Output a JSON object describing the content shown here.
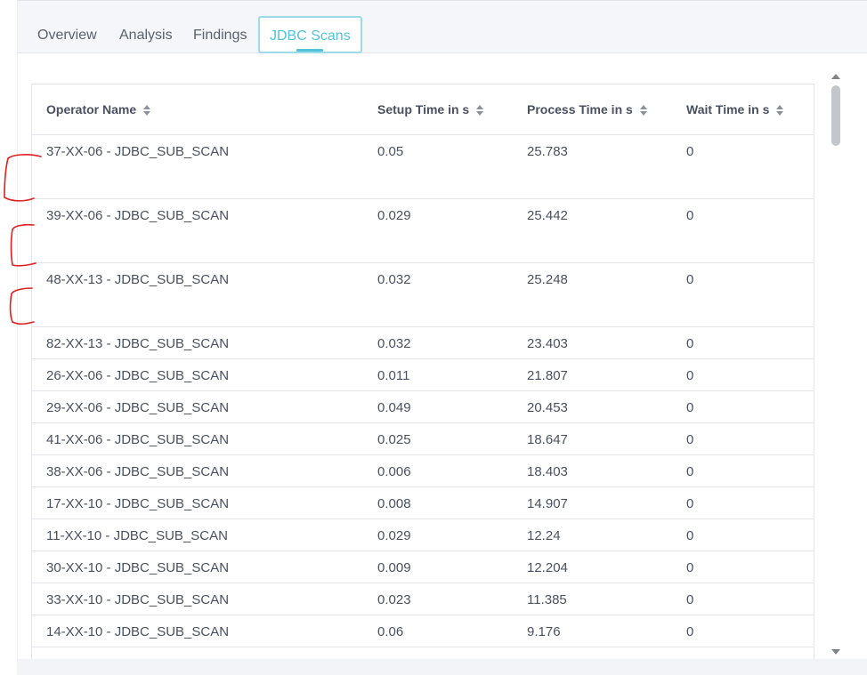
{
  "tabs": [
    {
      "label": "Overview",
      "active": false
    },
    {
      "label": "Analysis",
      "active": false
    },
    {
      "label": "Findings",
      "active": false
    },
    {
      "label": "JDBC Scans",
      "active": true
    }
  ],
  "colors": {
    "accent": "#4fc3d9",
    "annotation": "#e02020"
  },
  "table": {
    "columns": [
      "Operator Name",
      "Setup Time in s",
      "Process Time in s",
      "Wait Time in s"
    ],
    "rows": [
      [
        "37-XX-06 - JDBC_SUB_SCAN",
        "0.05",
        "25.783",
        "0"
      ],
      [
        "39-XX-06 - JDBC_SUB_SCAN",
        "0.029",
        "25.442",
        "0"
      ],
      [
        "48-XX-13 - JDBC_SUB_SCAN",
        "0.032",
        "25.248",
        "0"
      ],
      [
        "82-XX-13 - JDBC_SUB_SCAN",
        "0.032",
        "23.403",
        "0"
      ],
      [
        "26-XX-06 - JDBC_SUB_SCAN",
        "0.011",
        "21.807",
        "0"
      ],
      [
        "29-XX-06 - JDBC_SUB_SCAN",
        "0.049",
        "20.453",
        "0"
      ],
      [
        "41-XX-06 - JDBC_SUB_SCAN",
        "0.025",
        "18.647",
        "0"
      ],
      [
        "38-XX-06 - JDBC_SUB_SCAN",
        "0.006",
        "18.403",
        "0"
      ],
      [
        "17-XX-10 - JDBC_SUB_SCAN",
        "0.008",
        "14.907",
        "0"
      ],
      [
        "11-XX-10 - JDBC_SUB_SCAN",
        "0.029",
        "12.24",
        "0"
      ],
      [
        "30-XX-10 - JDBC_SUB_SCAN",
        "0.009",
        "12.204",
        "0"
      ],
      [
        "33-XX-10 - JDBC_SUB_SCAN",
        "0.023",
        "11.385",
        "0"
      ],
      [
        "14-XX-10 - JDBC_SUB_SCAN",
        "0.06",
        "9.176",
        "0"
      ]
    ]
  }
}
